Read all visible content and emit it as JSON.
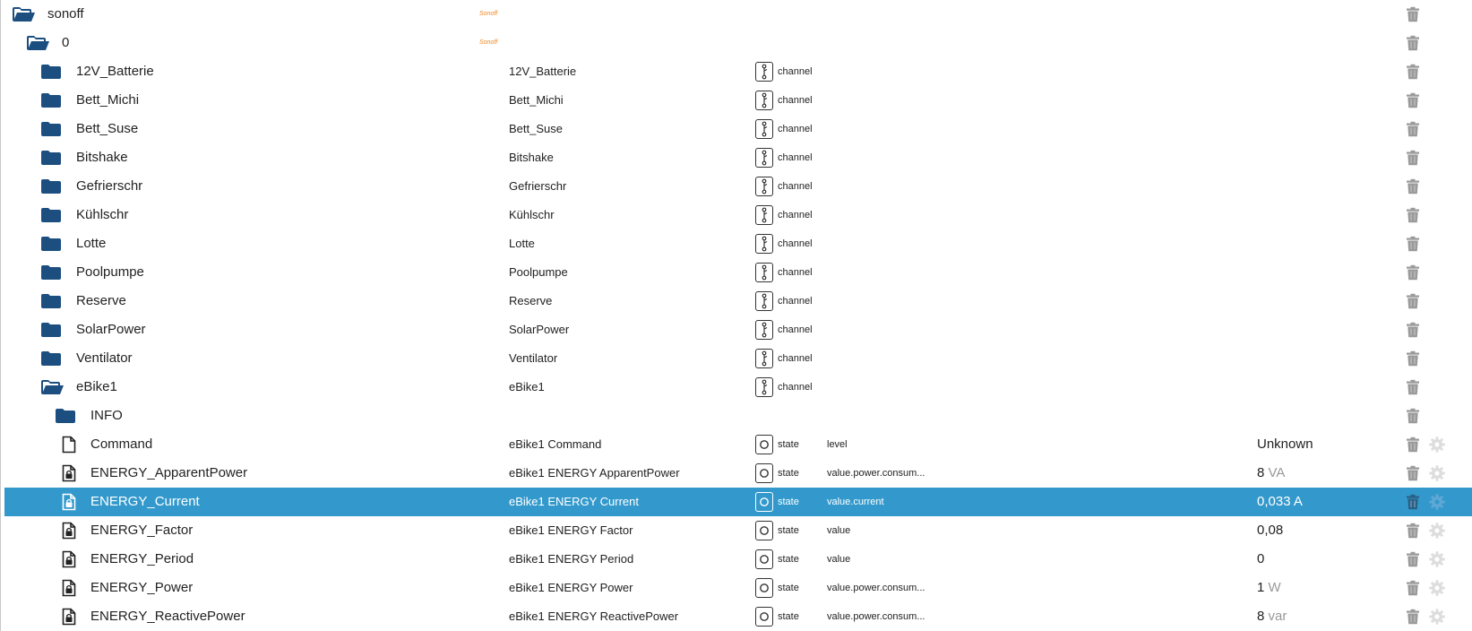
{
  "rows": [
    {
      "name": "sonoff",
      "depth": 0,
      "icon": "folder-open-icon",
      "label": "",
      "type": "",
      "role": "",
      "value": "",
      "unit": "",
      "logo": "Sonoff",
      "gear": false,
      "selected": false
    },
    {
      "name": "0",
      "depth": 1,
      "icon": "folder-open-icon",
      "label": "",
      "type": "",
      "role": "",
      "value": "",
      "unit": "",
      "logo": "Sonoff",
      "gear": false,
      "selected": false
    },
    {
      "name": "12V_Batterie",
      "depth": 2,
      "icon": "folder-icon",
      "label": "12V_Batterie",
      "type": "channel",
      "role": "",
      "value": "",
      "unit": "",
      "logo": "",
      "gear": false,
      "selected": false
    },
    {
      "name": "Bett_Michi",
      "depth": 2,
      "icon": "folder-icon",
      "label": "Bett_Michi",
      "type": "channel",
      "role": "",
      "value": "",
      "unit": "",
      "logo": "",
      "gear": false,
      "selected": false
    },
    {
      "name": "Bett_Suse",
      "depth": 2,
      "icon": "folder-icon",
      "label": "Bett_Suse",
      "type": "channel",
      "role": "",
      "value": "",
      "unit": "",
      "logo": "",
      "gear": false,
      "selected": false
    },
    {
      "name": "Bitshake",
      "depth": 2,
      "icon": "folder-icon",
      "label": "Bitshake",
      "type": "channel",
      "role": "",
      "value": "",
      "unit": "",
      "logo": "",
      "gear": false,
      "selected": false
    },
    {
      "name": "Gefrierschr",
      "depth": 2,
      "icon": "folder-icon",
      "label": "Gefrierschr",
      "type": "channel",
      "role": "",
      "value": "",
      "unit": "",
      "logo": "",
      "gear": false,
      "selected": false
    },
    {
      "name": "Kühlschr",
      "depth": 2,
      "icon": "folder-icon",
      "label": "Kühlschr",
      "type": "channel",
      "role": "",
      "value": "",
      "unit": "",
      "logo": "",
      "gear": false,
      "selected": false
    },
    {
      "name": "Lotte",
      "depth": 2,
      "icon": "folder-icon",
      "label": "Lotte",
      "type": "channel",
      "role": "",
      "value": "",
      "unit": "",
      "logo": "",
      "gear": false,
      "selected": false
    },
    {
      "name": "Poolpumpe",
      "depth": 2,
      "icon": "folder-icon",
      "label": "Poolpumpe",
      "type": "channel",
      "role": "",
      "value": "",
      "unit": "",
      "logo": "",
      "gear": false,
      "selected": false
    },
    {
      "name": "Reserve",
      "depth": 2,
      "icon": "folder-icon",
      "label": "Reserve",
      "type": "channel",
      "role": "",
      "value": "",
      "unit": "",
      "logo": "",
      "gear": false,
      "selected": false
    },
    {
      "name": "SolarPower",
      "depth": 2,
      "icon": "folder-icon",
      "label": "SolarPower",
      "type": "channel",
      "role": "",
      "value": "",
      "unit": "",
      "logo": "",
      "gear": false,
      "selected": false
    },
    {
      "name": "Ventilator",
      "depth": 2,
      "icon": "folder-icon",
      "label": "Ventilator",
      "type": "channel",
      "role": "",
      "value": "",
      "unit": "",
      "logo": "",
      "gear": false,
      "selected": false
    },
    {
      "name": "eBike1",
      "depth": 2,
      "icon": "folder-open-icon",
      "label": "eBike1",
      "type": "channel",
      "role": "",
      "value": "",
      "unit": "",
      "logo": "",
      "gear": false,
      "selected": false
    },
    {
      "name": "INFO",
      "depth": 3,
      "icon": "folder-icon",
      "label": "",
      "type": "",
      "role": "",
      "value": "",
      "unit": "",
      "logo": "",
      "gear": false,
      "selected": false
    },
    {
      "name": "Command",
      "depth": 3,
      "icon": "file-icon",
      "label": "eBike1 Command",
      "type": "state",
      "role": "level",
      "value": "Unknown",
      "unit": "",
      "logo": "",
      "gear": true,
      "selected": false
    },
    {
      "name": "ENERGY_ApparentPower",
      "depth": 3,
      "icon": "file-lock-icon",
      "label": "eBike1 ENERGY ApparentPower",
      "type": "state",
      "role": "value.power.consum...",
      "value": "8",
      "unit": "VA",
      "logo": "",
      "gear": true,
      "selected": false
    },
    {
      "name": "ENERGY_Current",
      "depth": 3,
      "icon": "file-lock-icon",
      "label": "eBike1 ENERGY Current",
      "type": "state",
      "role": "value.current",
      "value": "0,033",
      "unit": "A",
      "logo": "",
      "gear": true,
      "selected": true
    },
    {
      "name": "ENERGY_Factor",
      "depth": 3,
      "icon": "file-lock-icon",
      "label": "eBike1 ENERGY Factor",
      "type": "state",
      "role": "value",
      "value": "0,08",
      "unit": "",
      "logo": "",
      "gear": true,
      "selected": false
    },
    {
      "name": "ENERGY_Period",
      "depth": 3,
      "icon": "file-lock-icon",
      "label": "eBike1 ENERGY Period",
      "type": "state",
      "role": "value",
      "value": "0",
      "unit": "",
      "logo": "",
      "gear": true,
      "selected": false
    },
    {
      "name": "ENERGY_Power",
      "depth": 3,
      "icon": "file-lock-icon",
      "label": "eBike1 ENERGY Power",
      "type": "state",
      "role": "value.power.consum...",
      "value": "1",
      "unit": "W",
      "logo": "",
      "gear": true,
      "selected": false
    },
    {
      "name": "ENERGY_ReactivePower",
      "depth": 3,
      "icon": "file-lock-icon",
      "label": "eBike1 ENERGY ReactivePower",
      "type": "state",
      "role": "value.power.consum...",
      "value": "8",
      "unit": "var",
      "logo": "",
      "gear": true,
      "selected": false
    }
  ],
  "colors": {
    "folder": "#1c4f80",
    "selected_bg": "#3399cc",
    "trash": "#9a9a9a",
    "gear": "#dddddd",
    "logo": "#f08a24"
  }
}
